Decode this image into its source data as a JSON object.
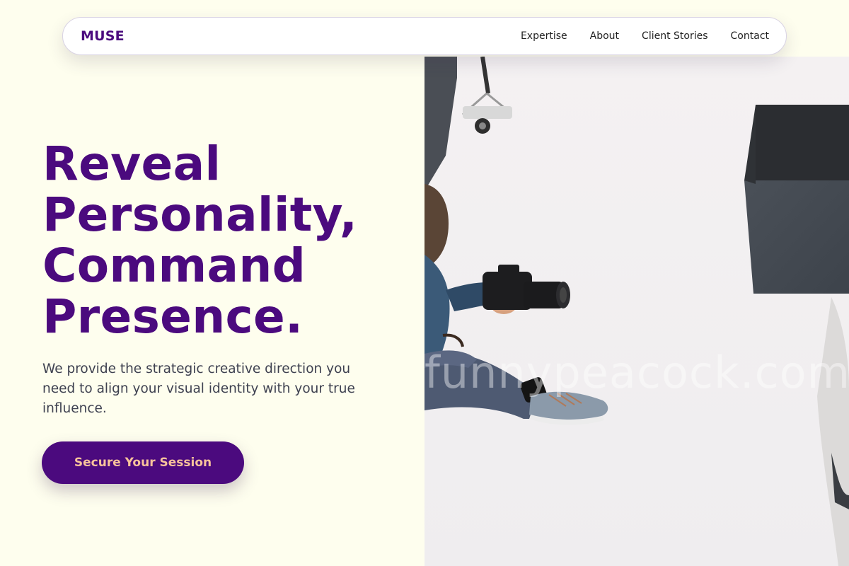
{
  "nav": {
    "logo": "MUSE",
    "links": [
      {
        "label": "Expertise"
      },
      {
        "label": "About"
      },
      {
        "label": "Client Stories"
      },
      {
        "label": "Contact"
      }
    ]
  },
  "hero": {
    "title_lines": [
      "Reveal",
      "Personality,",
      "Command",
      "Presence."
    ],
    "subtitle": "We provide the strategic creative direction you need to align your visual identity with your true influence.",
    "cta_label": "Secure Your Session",
    "image": {
      "description": "photographer-sitting-on-floor-with-camera",
      "watermark": "funnypeacock.com"
    }
  },
  "colors": {
    "page_bg": "#fefeee",
    "brand_purple": "#4b0a7e",
    "cta_text": "#f8c39b",
    "body_text": "#3e4150",
    "nav_text": "#222222"
  }
}
